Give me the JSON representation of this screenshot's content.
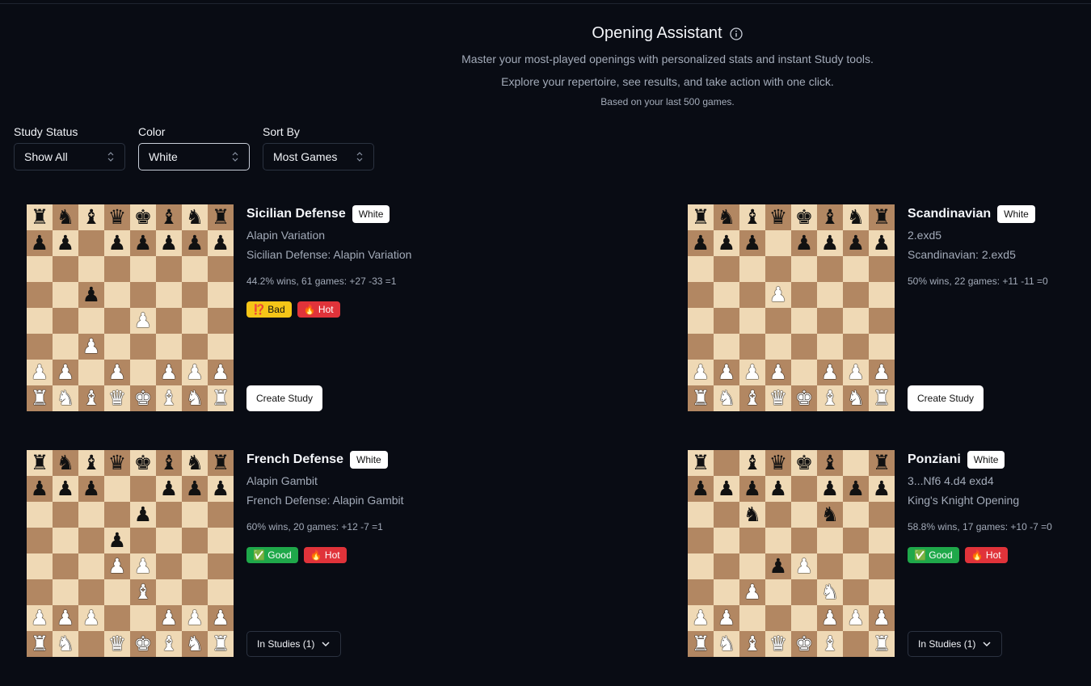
{
  "header": {
    "title": "Opening Assistant",
    "subtitle1": "Master your most-played openings with personalized stats and instant Study tools.",
    "subtitle2": "Explore your repertoire, see results, and take action with one click.",
    "based_on": "Based on your last 500 games."
  },
  "filters": {
    "study_status": {
      "label": "Study Status",
      "value": "Show All"
    },
    "color": {
      "label": "Color",
      "value": "White"
    },
    "sort_by": {
      "label": "Sort By",
      "value": "Most Games"
    }
  },
  "pieces": {
    "K": "♚",
    "Q": "♛",
    "R": "♜",
    "B": "♝",
    "N": "♞",
    "P": "♟",
    "k": "♚",
    "q": "♛",
    "r": "♜",
    "b": "♝",
    "n": "♞",
    "p": "♟"
  },
  "openings": [
    {
      "name": "Sicilian Defense",
      "color": "White",
      "variation": "Alapin Variation",
      "full_name": "Sicilian Defense: Alapin Variation",
      "stats": "44.2% wins, 61 games: +27 -33 =1",
      "tags": [
        {
          "kind": "bad",
          "label": "⁉️ Bad"
        },
        {
          "kind": "hot",
          "label": "🔥 Hot"
        }
      ],
      "action": {
        "kind": "create",
        "label": "Create Study"
      },
      "board": [
        "rnbqkbnr",
        "pp.ppppp",
        "........",
        "..p.....",
        "....P...",
        "..P.....",
        "PP.P.PPP",
        "RNBQKBNR"
      ]
    },
    {
      "name": "Scandinavian",
      "color": "White",
      "variation": "2.exd5",
      "full_name": "Scandinavian: 2.exd5",
      "stats": "50% wins, 22 games: +11 -11 =0",
      "tags": [],
      "action": {
        "kind": "create",
        "label": "Create Study"
      },
      "board": [
        "rnbqkbnr",
        "ppp.pppp",
        "........",
        "...P....",
        "........",
        "........",
        "PPPP.PPP",
        "RNBQKBNR"
      ]
    },
    {
      "name": "French Defense",
      "color": "White",
      "variation": "Alapin Gambit",
      "full_name": "French Defense: Alapin Gambit",
      "stats": "60% wins, 20 games: +12 -7 =1",
      "tags": [
        {
          "kind": "good",
          "label": "✅ Good"
        },
        {
          "kind": "hot",
          "label": "🔥 Hot"
        }
      ],
      "action": {
        "kind": "studies",
        "label": "In Studies (1)"
      },
      "board": [
        "rnbqkbnr",
        "ppp..ppp",
        "....p...",
        "...p....",
        "...PP...",
        "....B...",
        "PPP..PPP",
        "RN.QKBNR"
      ]
    },
    {
      "name": "Ponziani",
      "color": "White",
      "variation": "3...Nf6 4.d4 exd4",
      "full_name": "King's Knight Opening",
      "stats": "58.8% wins, 17 games: +10 -7 =0",
      "tags": [
        {
          "kind": "good",
          "label": "✅ Good"
        },
        {
          "kind": "hot",
          "label": "🔥 Hot"
        }
      ],
      "action": {
        "kind": "studies",
        "label": "In Studies (1)"
      },
      "board": [
        "r.bqkb.r",
        "pppp.ppp",
        "..n..n..",
        "........",
        "...pP...",
        "..P..N..",
        "PP...PPP",
        "RNBQKB.R"
      ]
    }
  ]
}
